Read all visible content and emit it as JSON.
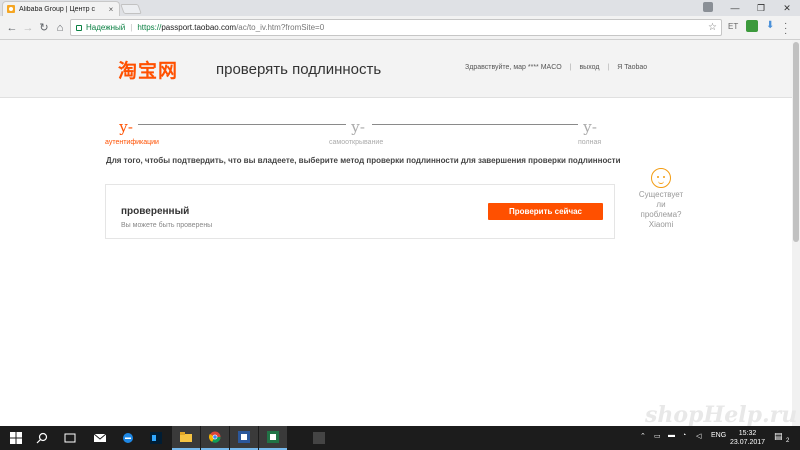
{
  "browser": {
    "tab_title": "Alibaba Group | Центр с",
    "tab_close": "×",
    "secure_label": "Надежный",
    "url_scheme": "https://",
    "url_host": "passport.taobao.com",
    "url_path": "/ac/to_iv.htm?fromSite=0",
    "ext_label": "ET"
  },
  "header": {
    "logo_text": "淘宝网",
    "title": "проверять подлинность",
    "greeting": "Здравствуйте, мар **** MACO",
    "logout": "выход",
    "my_taobao": "Я Taobao"
  },
  "steps": [
    {
      "mark": "у-",
      "label": "аутентификации",
      "active": true
    },
    {
      "mark": "у-",
      "label": "самооткрывание",
      "active": false
    },
    {
      "mark": "у-",
      "label": "полная",
      "active": false
    }
  ],
  "instruction": "Для того, чтобы подтвердить, что вы владеете, выберите метод проверки подлинности для завершения проверки подлинности",
  "verify": {
    "title": "проверенный",
    "subtitle": "Вы можете быть проверены",
    "button": "Проверить сейчас"
  },
  "help": {
    "text1": "Существует",
    "text2": "ли проблема?",
    "text3": "Xiaomi"
  },
  "watermark": "shopHelp.ru",
  "taskbar": {
    "lang": "ENG",
    "time": "15:32",
    "date": "23.07.2017",
    "notif_count": "2"
  },
  "colors": {
    "accent": "#ff5000",
    "secure_green": "#0b8043"
  }
}
